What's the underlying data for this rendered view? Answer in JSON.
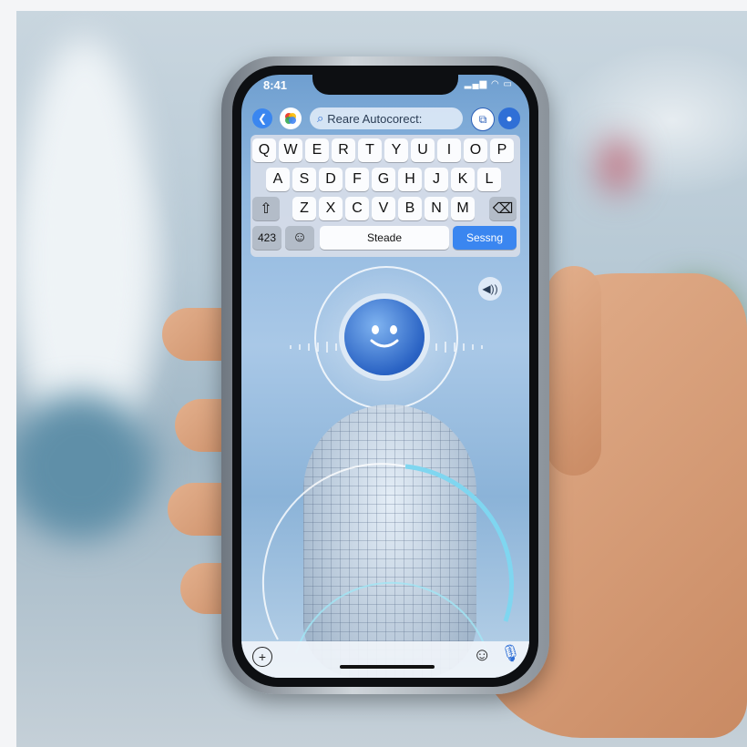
{
  "status": {
    "time": "8:41"
  },
  "search": {
    "text": "Reare Autocorect:"
  },
  "keyboard": {
    "row1": [
      "Q",
      "W",
      "E",
      "R",
      "T",
      "Y",
      "U",
      "I",
      "O",
      "P"
    ],
    "row2": [
      "A",
      "S",
      "D",
      "F",
      "G",
      "H",
      "J",
      "K",
      "L"
    ],
    "row3": [
      "Z",
      "X",
      "C",
      "V",
      "B",
      "N",
      "M"
    ],
    "numbers_key": "423",
    "space_label": "Steade",
    "action_label": "Sessng"
  },
  "colors": {
    "accent": "#3a86f0",
    "orb": "#2a63c4"
  },
  "icons": [
    "back-icon",
    "app-logo-icon",
    "search-icon",
    "share-icon",
    "microphone-icon",
    "shift-icon",
    "delete-icon",
    "emoji-icon",
    "speaker-icon",
    "plus-icon"
  ]
}
